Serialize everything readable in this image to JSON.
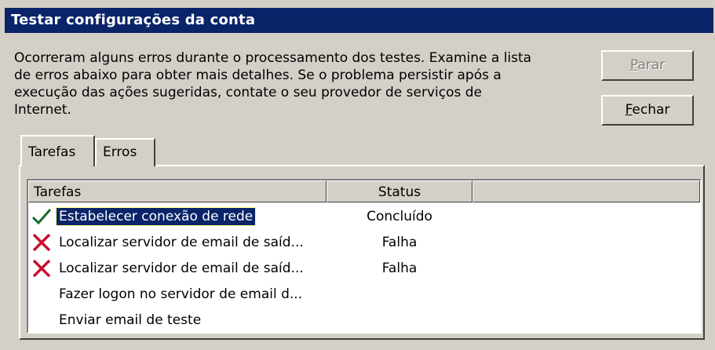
{
  "window": {
    "title": "Testar configurações da conta"
  },
  "message": "Ocorreram alguns erros durante o processamento dos testes. Examine a lista\nde erros abaixo para obter mais detalhes. Se o problema persistir após a\nexecução das ações sugeridas, contate o seu provedor de serviços de\nInternet.",
  "buttons": {
    "stop": {
      "accel": "P",
      "rest": "arar"
    },
    "close": {
      "accel": "F",
      "rest": "echar"
    }
  },
  "tabs": [
    {
      "label": "Tarefas",
      "active": true
    },
    {
      "label": "Erros",
      "active": false
    }
  ],
  "list": {
    "columns": [
      "Tarefas",
      "Status",
      ""
    ],
    "rows": [
      {
        "icon": "check-icon",
        "task": "Estabelecer conexão de rede",
        "status": "Concluído",
        "selected": true
      },
      {
        "icon": "red-x-icon",
        "task": "Localizar servidor de email de saíd...",
        "status": "Falha",
        "selected": false
      },
      {
        "icon": "red-x-icon",
        "task": "Localizar servidor de email de saíd...",
        "status": "Falha",
        "selected": false
      },
      {
        "icon": "",
        "task": "Fazer logon no servidor de email d...",
        "status": "",
        "selected": false
      },
      {
        "icon": "",
        "task": "Enviar email de teste",
        "status": "",
        "selected": false
      }
    ]
  },
  "colors": {
    "title_bar": "#0a246a",
    "check": "#1c6b2f",
    "error": "#c8102e",
    "face": "#d4d0c8"
  }
}
